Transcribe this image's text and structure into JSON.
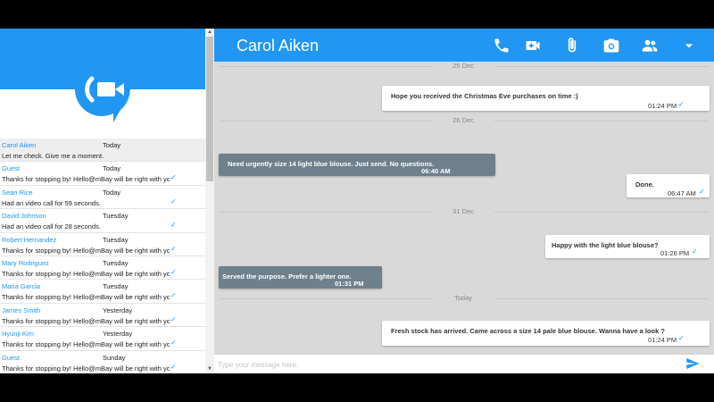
{
  "header": {
    "contact_name": "Carol Aiken",
    "icons": [
      "phone-icon",
      "video-camera-icon",
      "paperclip-icon",
      "camera-icon",
      "group-icon",
      "dropdown-caret-icon"
    ]
  },
  "contacts": [
    {
      "name": "Carol Aiken",
      "time": "Today",
      "message": "Let me check. Give me a moment.",
      "check": ""
    },
    {
      "name": "Guest",
      "time": "Today",
      "message": "Thanks for stopping by! Hello@mBay will be right with you.",
      "check": "✓"
    },
    {
      "name": "Sean Rice",
      "time": "Today",
      "message": "Had an video call for 59 seconds.",
      "check": "✓"
    },
    {
      "name": "David Johnson",
      "time": "Tuesday",
      "message": "Had an video call for 28 seconds.",
      "check": "✓"
    },
    {
      "name": "Robert Hernandez",
      "time": "Tuesday",
      "message": "Thanks for stopping by! Hello@mBay will be right with you.",
      "check": "✓"
    },
    {
      "name": "Mary Rodriguez",
      "time": "Tuesday",
      "message": "Thanks for stopping by! Hello@mBay will be right with you.",
      "check": "✓"
    },
    {
      "name": "Maria Garcia",
      "time": "Tuesday",
      "message": "Thanks for stopping by! Hello@mBay will be right with you.",
      "check": "✓"
    },
    {
      "name": "James Smith",
      "time": "Yesterday",
      "message": "Thanks for stopping by! Hello@mBay will be right with you.",
      "check": "✓"
    },
    {
      "name": "Hyunji Kim",
      "time": "Yesterday",
      "message": "Thanks for stopping by! Hello@mBay will be right with you.",
      "check": "✓"
    },
    {
      "name": "Guest",
      "time": "Sunday",
      "message": "Thanks for stopping by! Hello@mBay will be right with you.",
      "check": "✓"
    }
  ],
  "days": [
    "25 Dec",
    "26 Dec",
    "31 Dec",
    "Today"
  ],
  "messages": [
    {
      "direction": "out",
      "text": "Hope you received the Christmas Eve purchases on time :)",
      "time": "01:24 PM",
      "check": "✓"
    },
    {
      "direction": "in",
      "text": "Need urgently size 14 light blue blouse. Just send. No questions.",
      "time": "06:40 AM",
      "check": ""
    },
    {
      "direction": "out",
      "text": "Done.",
      "time": "06:47 AM",
      "check": "✓"
    },
    {
      "direction": "out",
      "text": "Happy with the light blue blouse?",
      "time": "01:26 PM",
      "check": "✓"
    },
    {
      "direction": "in",
      "text": "Served the purpose. Prefer a lighter one.",
      "time": "01:31 PM",
      "check": ""
    },
    {
      "direction": "out",
      "text": "Fresh stock has arrived. Came across a size 14 pale blue blouse. Wanna have a look ?",
      "time": "01:24 PM",
      "check": "✓"
    }
  ],
  "composer": {
    "placeholder": "Type your message here.",
    "value": ""
  },
  "colors": {
    "accent": "#2196f3",
    "chat_background": "#d9d9d9",
    "incoming_bubble": "#6d808c",
    "outgoing_bubble": "#ffffff"
  }
}
